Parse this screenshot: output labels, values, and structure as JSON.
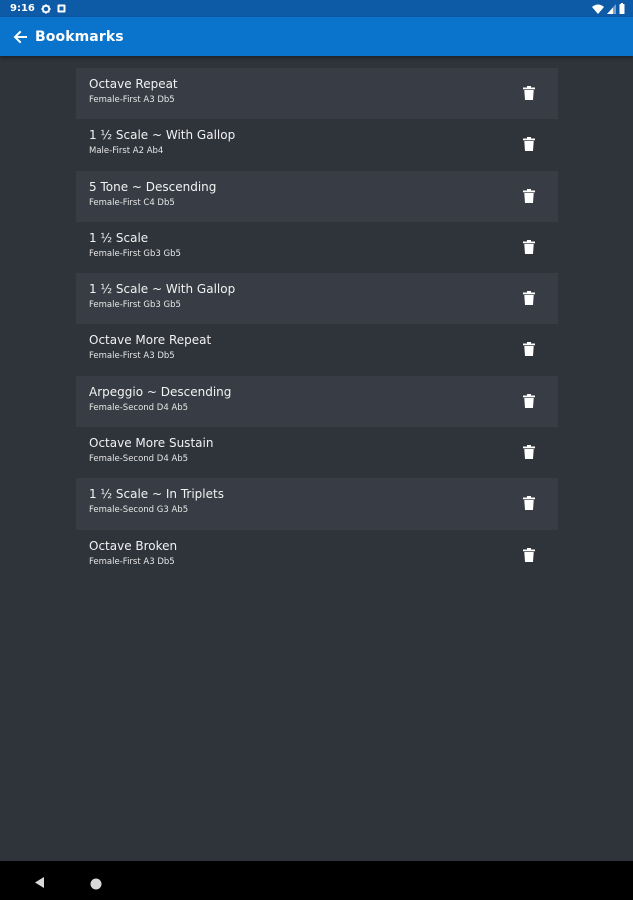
{
  "status_bar": {
    "time": "9:16",
    "icons": [
      "gear-icon",
      "notification-icon",
      "wifi-icon",
      "signal-icon",
      "battery-icon"
    ]
  },
  "app_bar": {
    "title": "Bookmarks",
    "back_icon": "arrow-left-icon"
  },
  "bookmarks": [
    {
      "title": "Octave Repeat",
      "subtitle": "Female-First A3 Db5"
    },
    {
      "title": "1 ½ Scale ~ With Gallop",
      "subtitle": "Male-First A2 Ab4"
    },
    {
      "title": "5 Tone ~ Descending",
      "subtitle": "Female-First C4 Db5"
    },
    {
      "title": "1 ½ Scale",
      "subtitle": "Female-First Gb3 Gb5"
    },
    {
      "title": "1 ½ Scale ~ With Gallop",
      "subtitle": "Female-First Gb3 Gb5"
    },
    {
      "title": "Octave More Repeat",
      "subtitle": "Female-First A3 Db5"
    },
    {
      "title": "Arpeggio ~ Descending",
      "subtitle": "Female-Second D4 Ab5"
    },
    {
      "title": "Octave More Sustain",
      "subtitle": "Female-Second D4 Ab5"
    },
    {
      "title": "1 ½ Scale ~ In Triplets",
      "subtitle": "Female-Second G3 Ab5"
    },
    {
      "title": "Octave Broken",
      "subtitle": "Female-First A3 Db5"
    }
  ],
  "colors": {
    "status_bar": "#0d5aa7",
    "app_bar": "#0a73cc",
    "background": "#2f333a",
    "row_alt": "#383d45",
    "nav_bar": "#000000"
  },
  "nav_bar": {
    "icons": [
      "nav-back-icon",
      "nav-home-icon"
    ]
  }
}
